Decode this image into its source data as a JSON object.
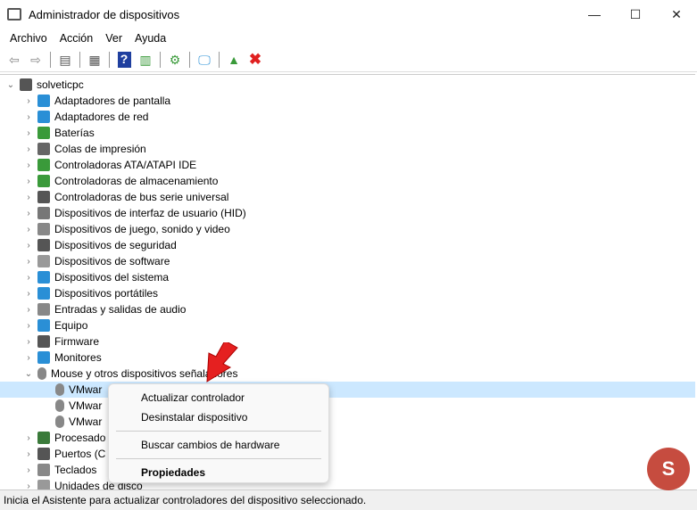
{
  "window": {
    "title": "Administrador de dispositivos",
    "minimize": "—",
    "maximize": "☐",
    "close": "✕"
  },
  "menu": [
    "Archivo",
    "Acción",
    "Ver",
    "Ayuda"
  ],
  "tree": {
    "root": "solveticpc",
    "categories": [
      {
        "label": "Adaptadores de pantalla",
        "color": "#2a8fd6"
      },
      {
        "label": "Adaptadores de red",
        "color": "#2a8fd6"
      },
      {
        "label": "Baterías",
        "color": "#3a9a3a"
      },
      {
        "label": "Colas de impresión",
        "color": "#666"
      },
      {
        "label": "Controladoras ATA/ATAPI IDE",
        "color": "#3a9a3a"
      },
      {
        "label": "Controladoras de almacenamiento",
        "color": "#3a9a3a"
      },
      {
        "label": "Controladoras de bus serie universal",
        "color": "#555"
      },
      {
        "label": "Dispositivos de interfaz de usuario (HID)",
        "color": "#777"
      },
      {
        "label": "Dispositivos de juego, sonido y video",
        "color": "#888"
      },
      {
        "label": "Dispositivos de seguridad",
        "color": "#555"
      },
      {
        "label": "Dispositivos de software",
        "color": "#999"
      },
      {
        "label": "Dispositivos del sistema",
        "color": "#2a8fd6"
      },
      {
        "label": "Dispositivos portátiles",
        "color": "#2a8fd6"
      },
      {
        "label": "Entradas y salidas de audio",
        "color": "#888"
      },
      {
        "label": "Equipo",
        "color": "#2a8fd6"
      },
      {
        "label": "Firmware",
        "color": "#555"
      },
      {
        "label": "Monitores",
        "color": "#2a8fd6"
      }
    ],
    "expanded": {
      "label": "Mouse y otros dispositivos señaladores",
      "children": [
        "VMwar",
        "VMwar",
        "VMwar"
      ]
    },
    "after": [
      {
        "label": "Procesado",
        "color": "#3a7a3a"
      },
      {
        "label": "Puertos (C",
        "color": "#555"
      },
      {
        "label": "Teclados",
        "color": "#888"
      },
      {
        "label": "Unidades de disco",
        "color": "#999"
      }
    ]
  },
  "context_menu": {
    "update": "Actualizar controlador",
    "uninstall": "Desinstalar dispositivo",
    "scan": "Buscar cambios de hardware",
    "properties": "Propiedades"
  },
  "status": "Inicia el Asistente para actualizar controladores del dispositivo seleccionado.",
  "watermark": "S"
}
